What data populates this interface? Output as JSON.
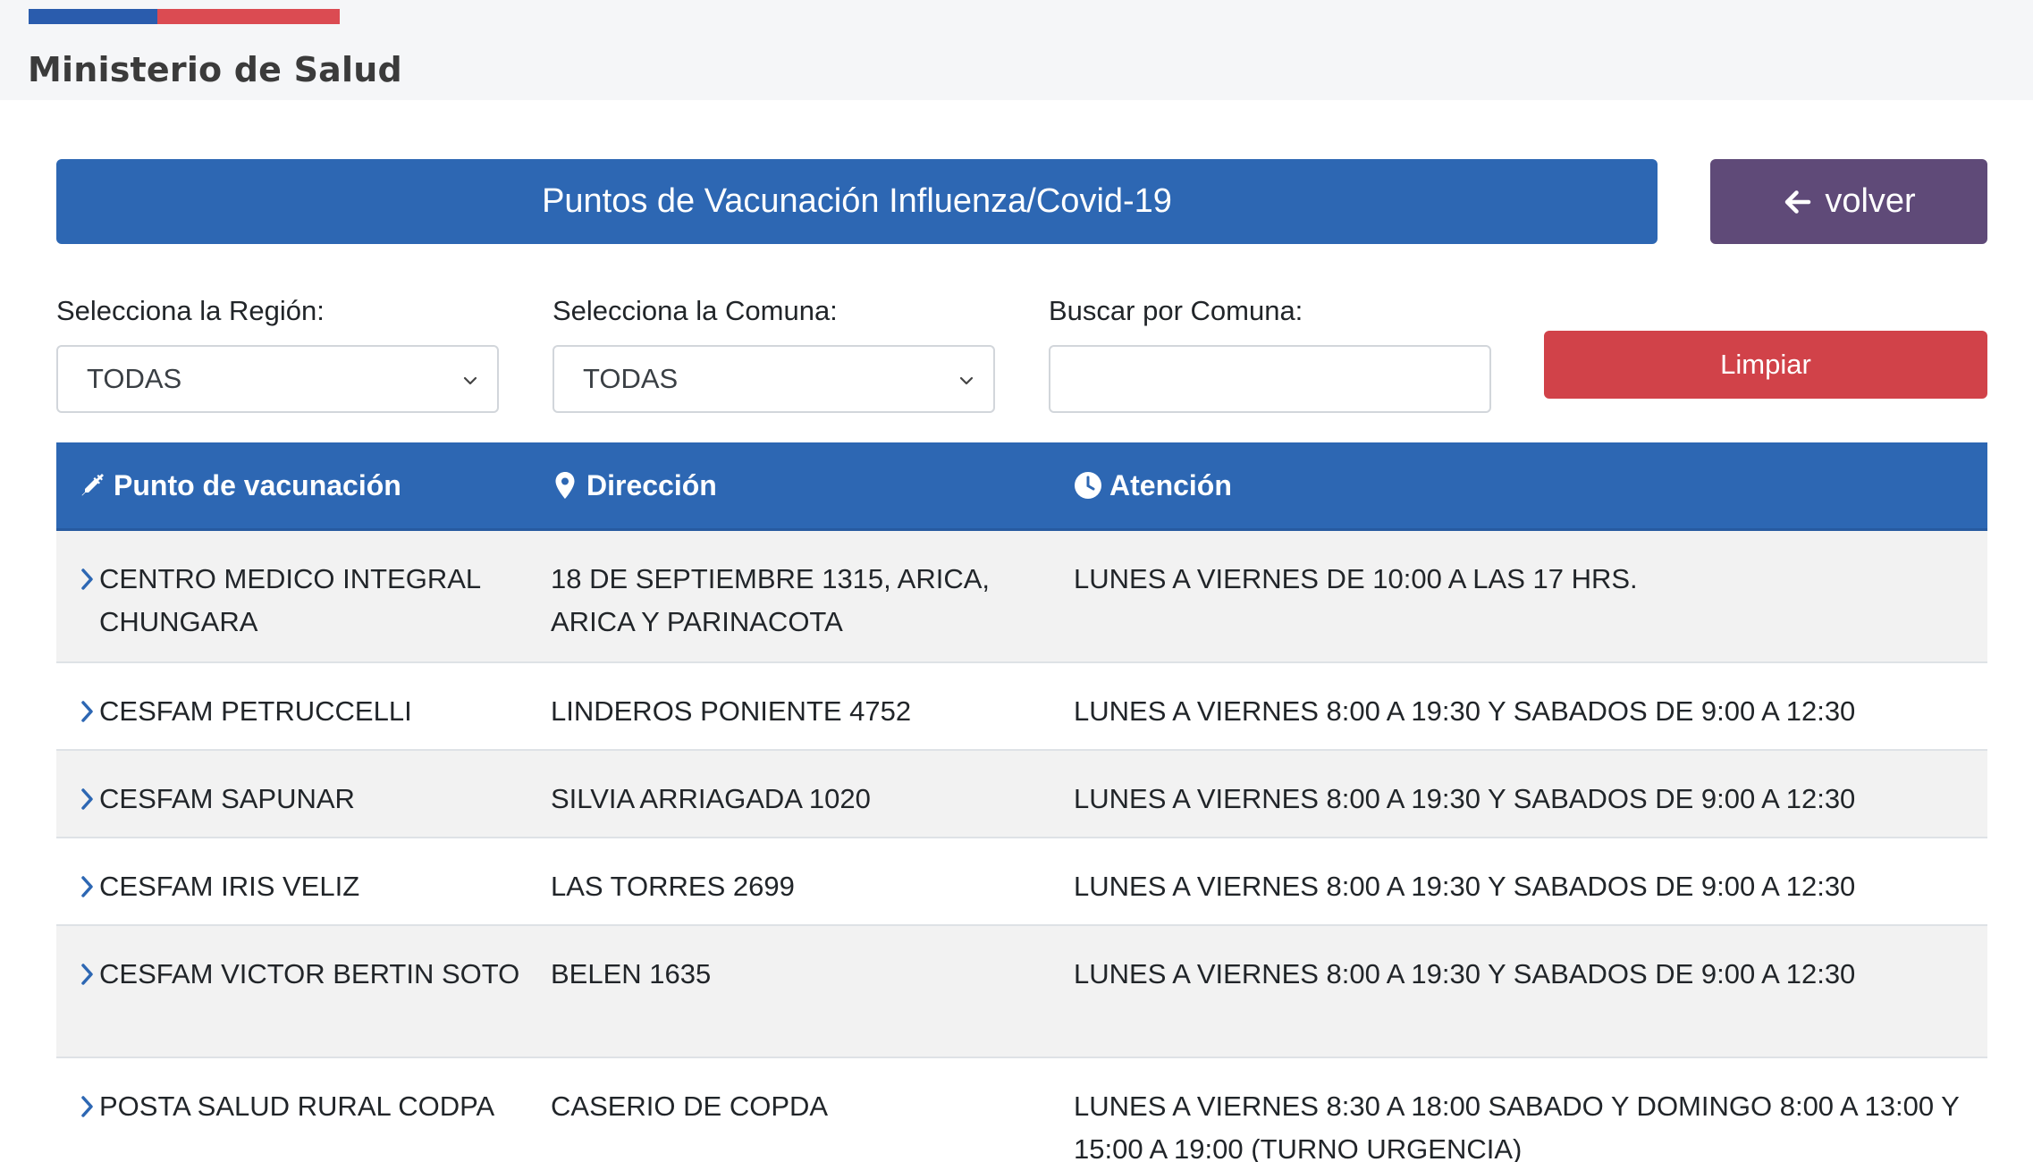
{
  "header": {
    "brand": "Ministerio de Salud"
  },
  "title_bar": {
    "title": "Puntos de Vacunación Influenza/Covid-19"
  },
  "back_button": {
    "label": "volver"
  },
  "filters": {
    "region_label": "Selecciona la Región:",
    "region_value": "TODAS",
    "comuna_label": "Selecciona la Comuna:",
    "comuna_value": "TODAS",
    "search_label": "Buscar por Comuna:",
    "search_value": "",
    "clear_label": "Limpiar"
  },
  "table": {
    "headers": [
      "Punto de vacunación",
      "Dirección",
      "Atención"
    ],
    "rows": [
      {
        "name": "CENTRO MEDICO INTEGRAL CHUNGARA",
        "address": "18 DE SEPTIEMBRE 1315, ARICA, ARICA Y PARINACOTA",
        "hours": "LUNES A VIERNES DE 10:00 A LAS 17 HRS."
      },
      {
        "name": "CESFAM PETRUCCELLI",
        "address": "LINDEROS PONIENTE 4752",
        "hours": "LUNES A VIERNES 8:00 A 19:30 Y SABADOS DE 9:00 A 12:30"
      },
      {
        "name": "CESFAM SAPUNAR",
        "address": "SILVIA ARRIAGADA 1020",
        "hours": "LUNES A VIERNES 8:00 A 19:30 Y SABADOS DE 9:00 A 12:30"
      },
      {
        "name": "CESFAM IRIS VELIZ",
        "address": "LAS TORRES 2699",
        "hours": "LUNES A VIERNES 8:00 A 19:30 Y SABADOS DE 9:00 A 12:30"
      },
      {
        "name": "CESFAM VICTOR BERTIN SOTO",
        "address": "BELEN 1635",
        "hours": "LUNES A VIERNES 8:00 A 19:30 Y SABADOS DE 9:00 A 12:30"
      },
      {
        "name": "POSTA SALUD RURAL CODPA",
        "address": "CASERIO DE COPDA",
        "hours": "LUNES A VIERNES 8:30 A 18:00 SABADO Y DOMINGO 8:00 A 13:00 Y 15:00 A 19:00 (TURNO URGENCIA)"
      }
    ]
  },
  "colors": {
    "primary": "#2d67b3",
    "back": "#5f4a78",
    "danger": "#d14249",
    "flag_blue": "#2a5cad",
    "flag_red": "#db4b52"
  },
  "icons": {
    "back": "arrow-left-icon",
    "syringe": "syringe-icon",
    "location": "map-marker-icon",
    "clock": "clock-icon",
    "row": "chevron-right-icon",
    "select": "chevron-down-icon"
  }
}
